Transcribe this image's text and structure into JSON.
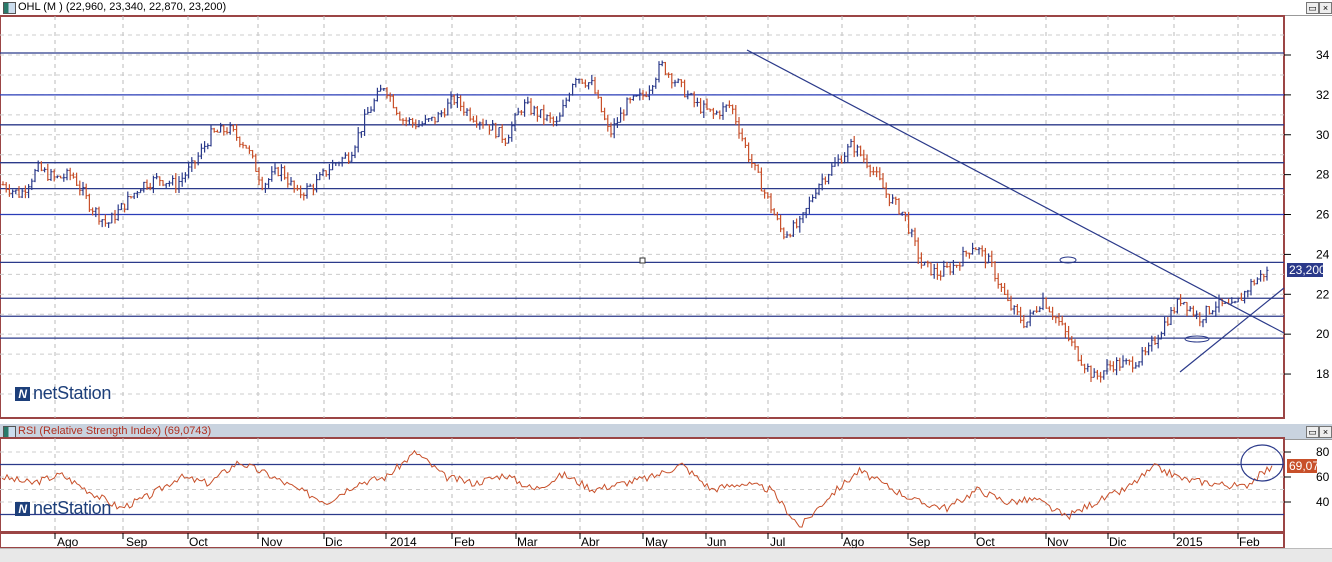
{
  "price_window": {
    "title": "OHL (M ) (22,960, 23,340, 22,870, 23,200)",
    "last_label": "23,200"
  },
  "rsi_window": {
    "title": "RSI (Relative Strength Index) (69,0743)",
    "last_label": "69,07"
  },
  "logo": "netStation",
  "colors": {
    "up": "#2b3a8a",
    "down": "#c8502a",
    "frame": "#9b4545",
    "hline": "#2b3a8a",
    "rsi": "#c8502a"
  },
  "chart_data": [
    {
      "type": "ohlc",
      "title": "OHL (M )",
      "ylim": [
        16,
        35
      ],
      "yticks": [
        "18",
        "20",
        "22",
        "24",
        "26",
        "28",
        "30",
        "32",
        "34"
      ],
      "last": {
        "open": 22.96,
        "high": 23.34,
        "low": 22.87,
        "close": 23.2
      },
      "x_labels": [
        "Ago",
        "Sep",
        "Oct",
        "Nov",
        "Dic",
        "2014",
        "Feb",
        "Mar",
        "Abr",
        "May",
        "Jun",
        "Jul",
        "Ago",
        "Sep",
        "Oct",
        "Nov",
        "Dic",
        "2015",
        "Feb"
      ],
      "horizontal_levels": [
        34.1,
        32,
        30.5,
        28.6,
        27.3,
        26,
        23.6,
        21.8,
        20.9,
        19.8
      ],
      "close_path": [
        27.5,
        27,
        28.3,
        27.8,
        28,
        26.5,
        25.5,
        26.5,
        27.5,
        27.8,
        27.5,
        28.5,
        30,
        30.3,
        29.5,
        27.5,
        28.3,
        27,
        27.5,
        28.5,
        29,
        31,
        32.5,
        30.8,
        30.5,
        30.8,
        31.8,
        31,
        30.5,
        29.8,
        31.5,
        31,
        30.5,
        33,
        32.5,
        30,
        31.5,
        32,
        33.5,
        32.5,
        31.5,
        31,
        31.5,
        29,
        27,
        25,
        25.5,
        27.5,
        28.5,
        29.5,
        28.5,
        27,
        26,
        23.5,
        23,
        23.5,
        24.5,
        23.5,
        21.5,
        20.5,
        21.8,
        20.5,
        19,
        17.8,
        18.5,
        18.5,
        19,
        20.5,
        21.8,
        20.8,
        21.5,
        21.3,
        22.5,
        23.2
      ]
    },
    {
      "type": "line",
      "title": "RSI (Relative Strength Index)",
      "ylim": [
        20,
        90
      ],
      "yticks": [
        "40",
        "60",
        "80"
      ],
      "levels": [
        70,
        30
      ],
      "values": [
        60,
        55,
        62,
        48,
        35,
        45,
        60,
        55,
        72,
        62,
        50,
        40,
        55,
        60,
        80,
        60,
        55,
        62,
        50,
        62,
        50,
        55,
        60,
        70,
        50,
        55,
        50,
        20,
        45,
        65,
        52,
        40,
        35,
        50,
        40,
        42,
        28,
        40,
        50,
        68,
        58,
        55,
        52,
        69.07
      ]
    }
  ]
}
